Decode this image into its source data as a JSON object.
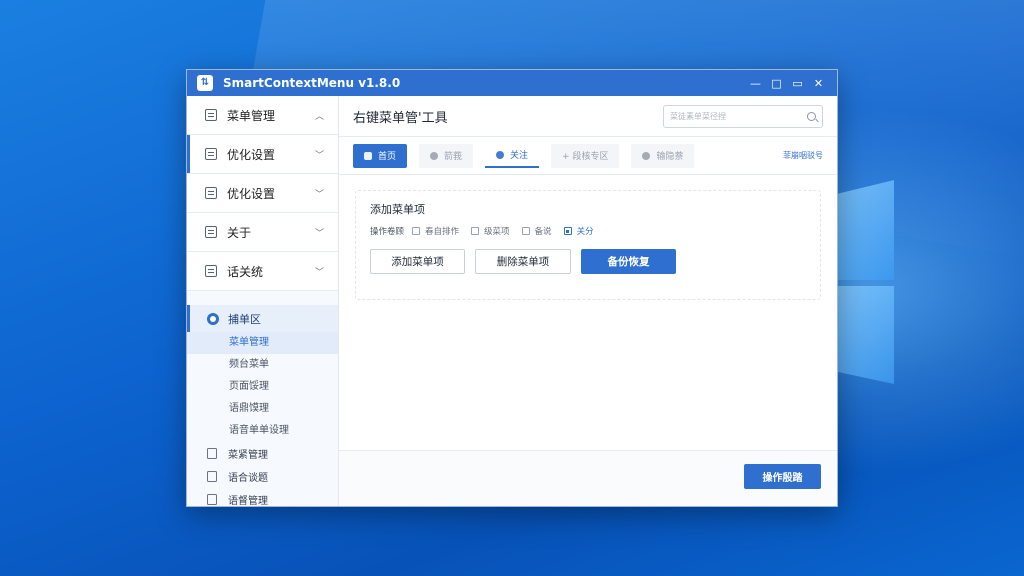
{
  "window": {
    "title": "SmartContextMenu v1.8.0",
    "minimize": "—",
    "maximize": "□",
    "restore": "▭",
    "close": "✕"
  },
  "sidebar": {
    "groups": [
      {
        "label": "菜单管理",
        "chevron": "︿"
      },
      {
        "label": "优化设置",
        "chevron": "﹀"
      },
      {
        "label": "优化设置",
        "chevron": "﹀"
      },
      {
        "label": "关于",
        "chevron": "﹀"
      },
      {
        "label": "话关统",
        "chevron": "﹀"
      }
    ],
    "section": {
      "label": "捕单区",
      "subitems": [
        "菜单管理",
        "频台菜单",
        "页面馁理",
        "语鼎馍理",
        "语音单单设理"
      ]
    },
    "items": [
      "菜紧管理",
      "语合谈题",
      "语督管理"
    ]
  },
  "main": {
    "title": "右键菜单管'工具",
    "search_placeholder": "菜徒素单菜径捏",
    "tabs": [
      "首页",
      "箭莪",
      "关注",
      "+ 段核专区",
      "输隐萘"
    ],
    "tab_link": "菲崩咽驳号",
    "card": {
      "title": "添加菜单项",
      "options_label": "操作卷顾",
      "options": [
        "春自排作",
        "级菜项",
        "备说",
        "关分"
      ],
      "buttons": {
        "add": "添加菜单项",
        "delete": "删除菜单项",
        "backup": "备份恢复"
      }
    },
    "footer_button": "操作殷踏"
  },
  "colors": {
    "accent": "#2f6fcf"
  }
}
